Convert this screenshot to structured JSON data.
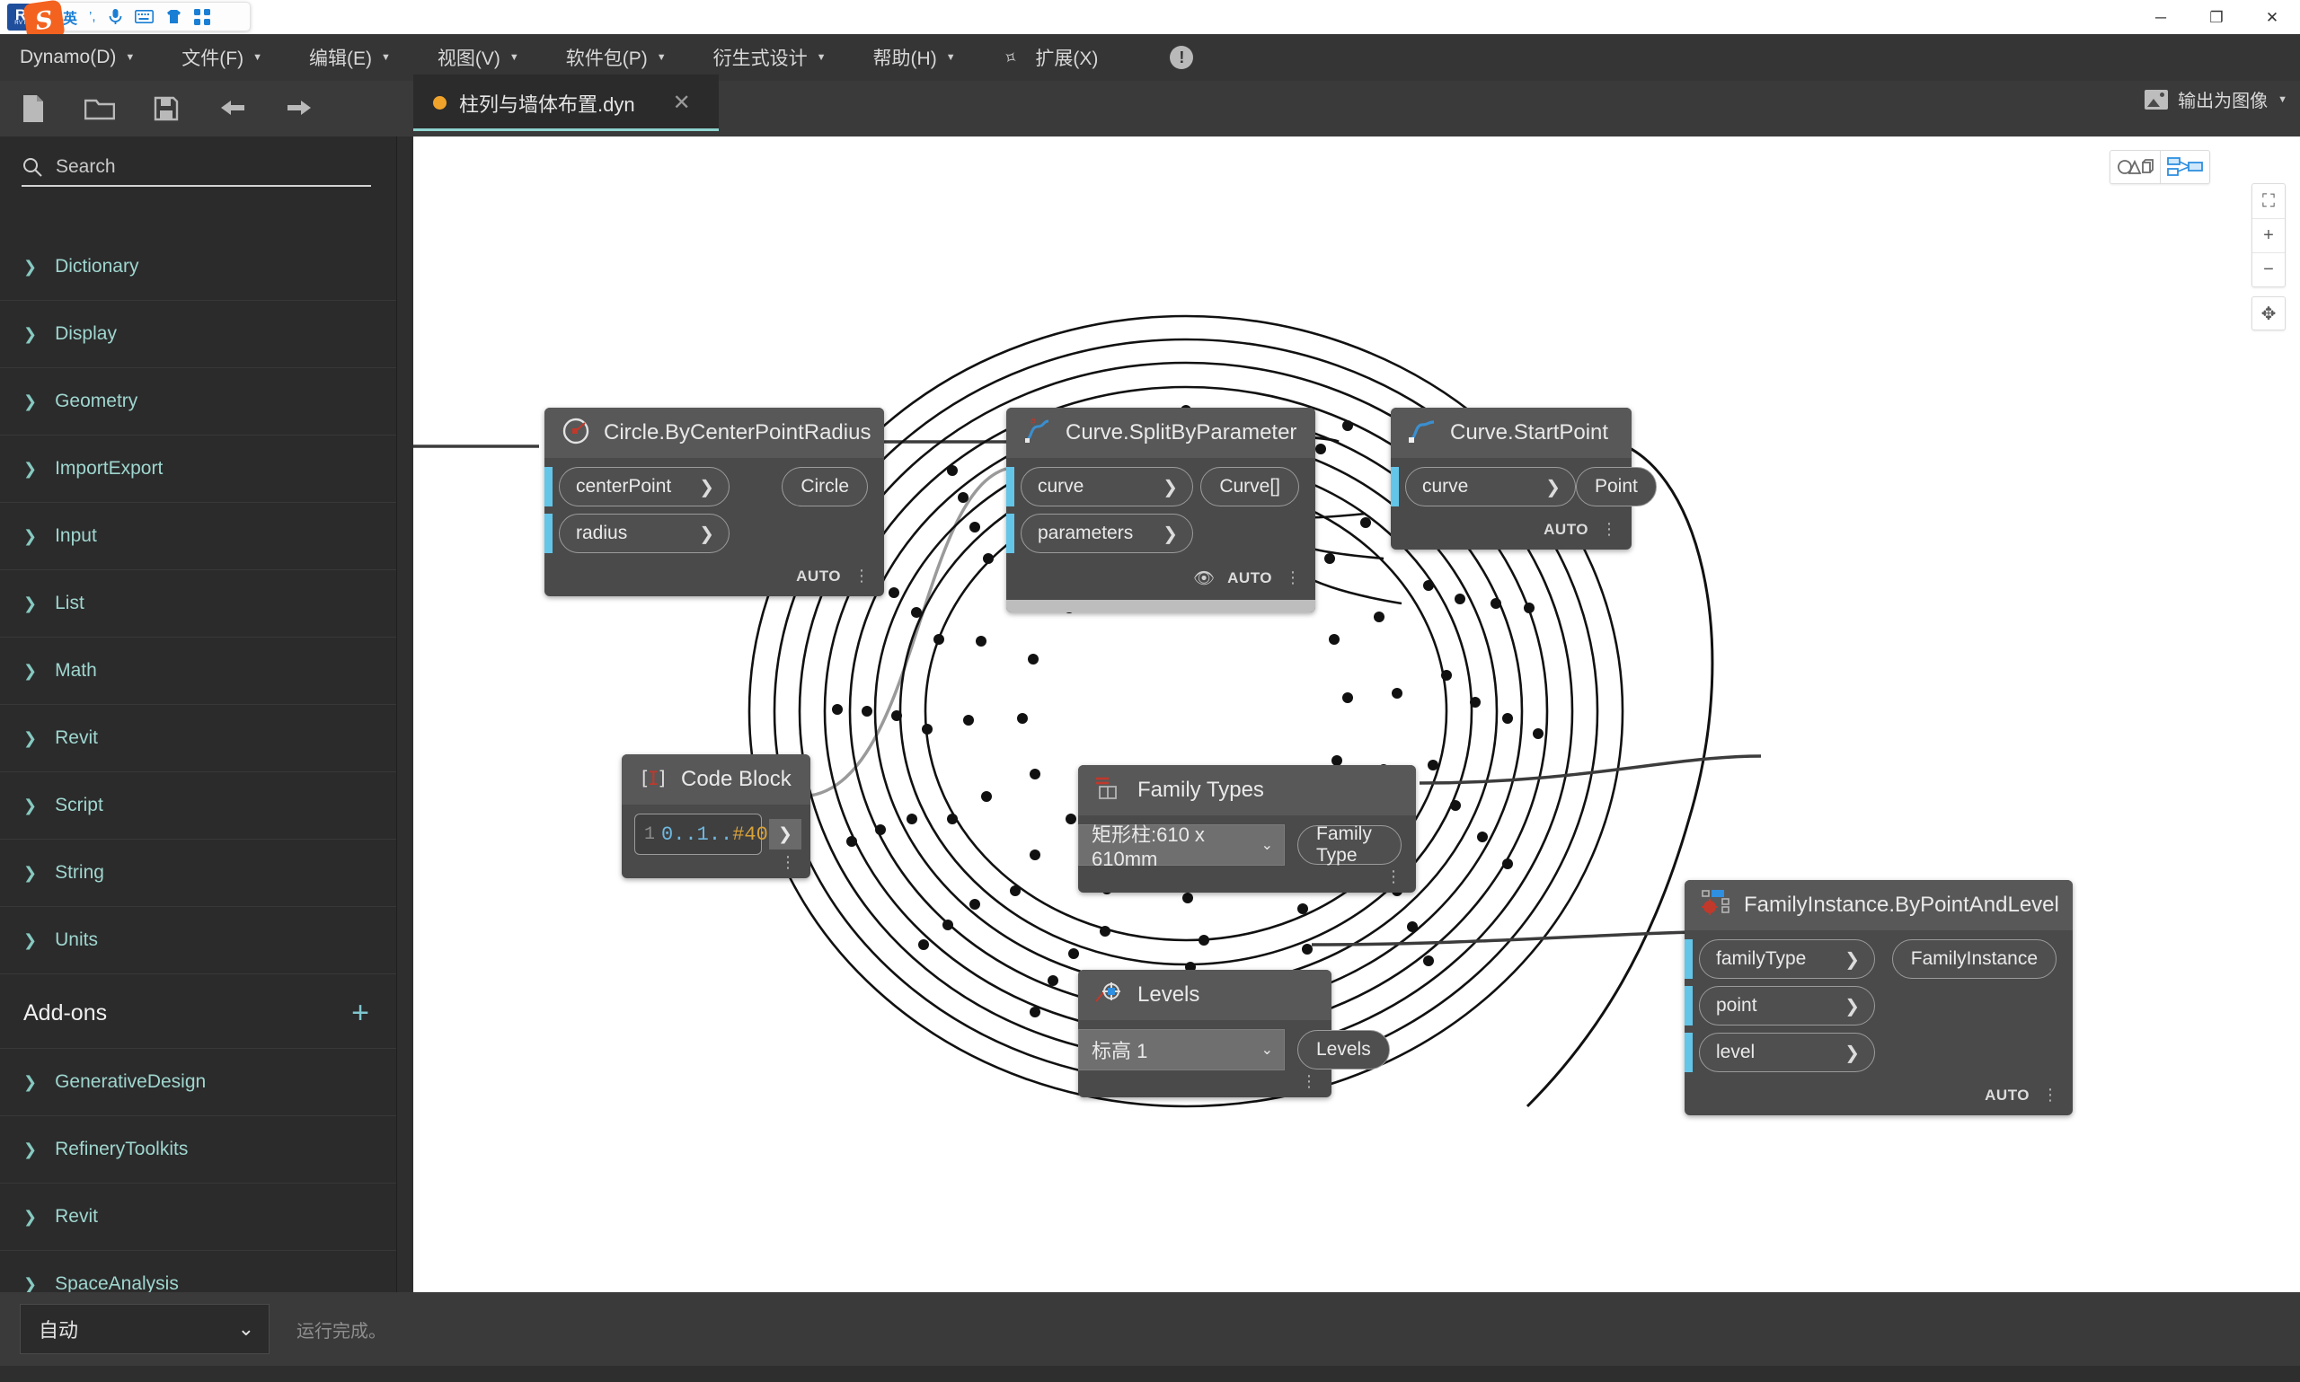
{
  "window": {
    "app_badge": "R",
    "app_badge_sub": "RVT",
    "minimize": "─",
    "maximize": "❐",
    "close": "✕"
  },
  "ime": {
    "logo": "S",
    "lang": "英",
    "punctuation": "’,",
    "mic": "mic-icon",
    "keyboard": "keyboard-icon",
    "skin": "skin-icon",
    "toolbox": "toolbox-icon"
  },
  "menubar": {
    "items": [
      {
        "label": "Dynamo(D)",
        "accel": "D",
        "caret": "▼"
      },
      {
        "label": "文件(F)",
        "accel": "F",
        "caret": "▼"
      },
      {
        "label": "编辑(E)",
        "accel": "E",
        "caret": "▼"
      },
      {
        "label": "视图(V)",
        "accel": "V",
        "caret": "▼"
      },
      {
        "label": "软件包(P)",
        "accel": "P",
        "caret": "▼"
      },
      {
        "label": "衍生式设计",
        "accel": "",
        "caret": "▼"
      },
      {
        "label": "帮助(H)",
        "accel": "H",
        "caret": "▼"
      }
    ],
    "extension_label": "扩展(X)",
    "warning_glyph": "!"
  },
  "toolbar": {
    "icons": [
      "new-file-icon",
      "open-folder-icon",
      "save-icon",
      "undo-icon",
      "redo-icon"
    ],
    "export_label": "输出为图像",
    "export_caret": "▼"
  },
  "tab": {
    "filename": "柱列与墙体布置.dyn",
    "modified_dot": "●",
    "close": "✕"
  },
  "sidebar": {
    "search_placeholder": "Search",
    "library": [
      {
        "label": "Dictionary"
      },
      {
        "label": "Display"
      },
      {
        "label": "Geometry"
      },
      {
        "label": "ImportExport"
      },
      {
        "label": "Input"
      },
      {
        "label": "List"
      },
      {
        "label": "Math"
      },
      {
        "label": "Revit"
      },
      {
        "label": "Script"
      },
      {
        "label": "String"
      },
      {
        "label": "Units"
      }
    ],
    "addons_title": "Add-ons",
    "addons_plus": "+",
    "addons": [
      {
        "label": "GenerativeDesign"
      },
      {
        "label": "RefineryToolkits"
      },
      {
        "label": "Revit"
      },
      {
        "label": "SpaceAnalysis"
      }
    ],
    "chevron": "❯"
  },
  "canvas": {
    "view_toggle": [
      "3d-geometry-view-icon",
      "graph-view-icon"
    ],
    "nav": {
      "fit": "⛶",
      "zoom_in": "+",
      "zoom_out": "−",
      "pan": "✥"
    },
    "nodes": [
      {
        "id": "circle",
        "title": "Circle.ByCenterPointRadius",
        "icon": "circle-radius-icon",
        "inputs": [
          "centerPoint",
          "radius"
        ],
        "outputs": [
          "Circle"
        ],
        "footer": "AUTO"
      },
      {
        "id": "split",
        "title": "Curve.SplitByParameter",
        "icon": "curve-split-icon",
        "inputs": [
          "curve",
          "parameters"
        ],
        "outputs": [
          "Curve[]"
        ],
        "footer": "AUTO",
        "preview_off": true
      },
      {
        "id": "startpoint",
        "title": "Curve.StartPoint",
        "icon": "curve-startpoint-icon",
        "inputs": [
          "curve"
        ],
        "outputs": [
          "Point"
        ],
        "footer": "AUTO"
      },
      {
        "id": "codeblock",
        "title": "Code Block",
        "icon": "code-block-icon",
        "line_number": "1",
        "code_range": "0..1..",
        "code_count": "#40",
        "code_end": ";",
        "code_full": "0..1..#40;",
        "output_arrow": "❯"
      },
      {
        "id": "familytypes",
        "title": "Family Types",
        "icon": "family-types-icon",
        "selected": "矩形柱:610 x 610mm",
        "outputs": [
          "Family Type"
        ]
      },
      {
        "id": "levels",
        "title": "Levels",
        "icon": "levels-icon",
        "selected": "标高 1",
        "outputs": [
          "Levels"
        ]
      },
      {
        "id": "familyinstance",
        "title": "FamilyInstance.ByPointAndLevel",
        "icon": "family-instance-icon",
        "inputs": [
          "familyType",
          "point",
          "level"
        ],
        "outputs": [
          "FamilyInstance"
        ],
        "footer": "AUTO"
      }
    ],
    "port_arrow": "❯",
    "dropdown_caret": "⌄"
  },
  "statusbar": {
    "run_mode": "自动",
    "run_caret": "⌄",
    "run_status": "运行完成。"
  },
  "colors": {
    "accent_teal": "#9fd6cf",
    "port_blue": "#63c5e8",
    "tab_dot": "#f0a32b",
    "canvas_bg": "#ffffff",
    "node_bg": "#4a4a4a",
    "node_head": "#585858"
  }
}
